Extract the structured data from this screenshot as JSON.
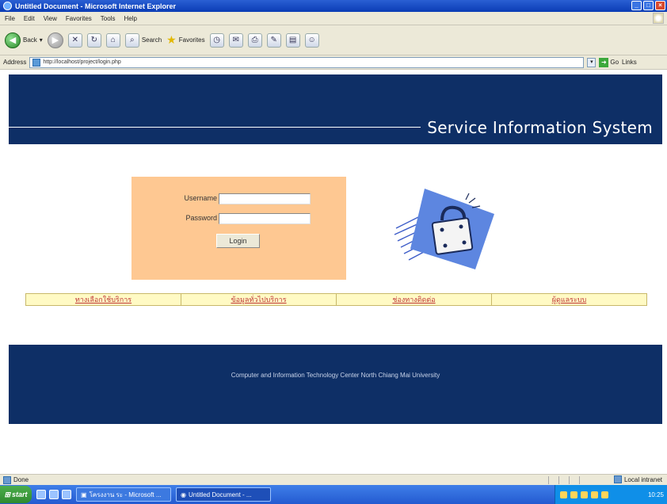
{
  "window": {
    "title": "Untitled Document - Microsoft Internet Explorer",
    "controls": [
      "_",
      "□",
      "×"
    ]
  },
  "menu": [
    "File",
    "Edit",
    "View",
    "Favorites",
    "Tools",
    "Help"
  ],
  "toolbar": {
    "back_label": "Back",
    "search_label": "Search",
    "favorites_label": "Favorites"
  },
  "address": {
    "label": "Address",
    "url": "http://localhost/project/login.php",
    "go_label": "Go",
    "links_label": "Links"
  },
  "page": {
    "header_title": "Service Information System",
    "login": {
      "username_label": "Username",
      "password_label": "Password",
      "username_value": "",
      "password_value": "",
      "login_button": "Login"
    },
    "nav": [
      "ทางเลือกใช้บริการ",
      "ข้อมูลทั่วไปบริการ",
      "ช่องทางติดต่อ",
      "ผู้ดูแลระบบ"
    ],
    "footer_text": "Computer and Information Technology Center North Chiang Mai University"
  },
  "status": {
    "text": "Done",
    "zone": "Local intranet"
  },
  "taskbar": {
    "start_label": "start",
    "tasks": [
      {
        "label": "โครงงาน ระ - Microsoft ...",
        "active": false
      },
      {
        "label": "Untitled Document - ...",
        "active": true
      }
    ],
    "clock": "10:25"
  }
}
